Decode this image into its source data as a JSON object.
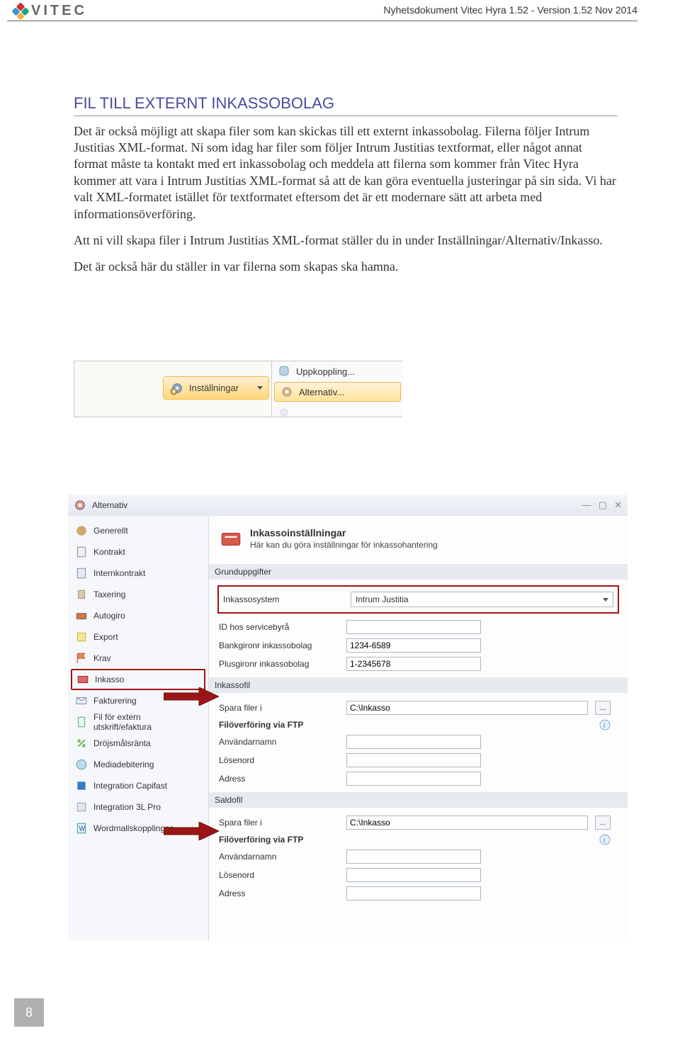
{
  "header": {
    "brand": "VITEC",
    "doc_title": "Nyhetsdokument Vitec Hyra 1.52 - Version 1.52 Nov 2014"
  },
  "page_number": "8",
  "section_heading": "FIL TILL EXTERNT INKASSOBOLAG",
  "paragraphs": {
    "p1": "Det är också möjligt att skapa filer som kan skickas till ett externt inkassobolag. Filerna följer Intrum Justitias XML-format. Ni som idag har filer som följer Intrum Justitias textformat, eller något annat format måste ta kontakt med ert inkassobolag och meddela att filerna som kommer från Vitec Hyra kommer att vara i Intrum Justitias XML-format så att de kan göra eventuella justeringar på sin sida. Vi har valt XML-formatet istället för textformatet eftersom det är ett modernare sätt att arbeta med informationsöverföring.",
    "p2": "Att ni vill skapa filer i Intrum Justitias XML-format ställer du in under Inställningar/Alternativ/Inkasso.",
    "p3": "Det är också här du ställer in var filerna som skapas ska hamna."
  },
  "shot1": {
    "ribbon_button": "Inställningar",
    "menu_item1": "Uppkoppling...",
    "menu_item2": "Alternativ..."
  },
  "shot2": {
    "window_title": "Alternativ",
    "sidebar": [
      "Generellt",
      "Kontrakt",
      "Internkontrakt",
      "Taxering",
      "Autogiro",
      "Export",
      "Krav",
      "Inkasso",
      "Fakturering",
      "Fil för extern utskrift/efaktura",
      "Dröjsmålsränta",
      "Mediadebitering",
      "Integration Capifast",
      "Integration 3L Pro",
      "Wordmallskopplingar"
    ],
    "panel_title": "Inkassoinställningar",
    "panel_sub": "Här kan du göra inställningar för inkassohantering",
    "section1": "Grunduppgifter",
    "row_inkassosystem_label": "Inkassosystem",
    "row_inkassosystem_value": "Intrum Justitia",
    "row_id_label": "ID hos servicebyrå",
    "row_bankgiro_label": "Bankgironr inkassobolag",
    "row_bankgiro_value": "1234-6589",
    "row_plusgiro_label": "Plusgironr inkassobolag",
    "row_plusgiro_value": "1-2345678",
    "section2": "Inkassofil",
    "row_spara1_label": "Spara filer i",
    "row_spara1_value": "C:\\Inkasso",
    "ftp_label": "Filöverföring via FTP",
    "row_user_label": "Användarnamn",
    "row_pwd_label": "Lösenord",
    "row_addr_label": "Adress",
    "section3": "Saldofil",
    "row_spara2_label": "Spara filer i",
    "row_spara2_value": "C:\\Inkasso",
    "browse": "..."
  }
}
